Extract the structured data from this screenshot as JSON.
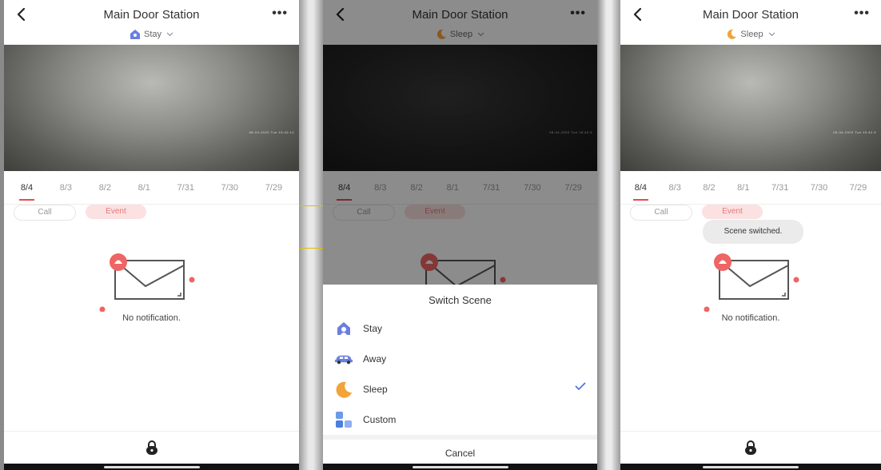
{
  "screens": [
    {
      "title": "Main Door Station",
      "more": "•••",
      "scene": "Stay",
      "stamp": "08-04-2020 Tue 15:42:12",
      "dates": [
        "8/4",
        "8/3",
        "8/2",
        "8/1",
        "7/31",
        "7/30",
        "7/29"
      ],
      "call_label": "Call",
      "event_label": "Event",
      "empty_message": "No notification."
    },
    {
      "title": "Main Door Station",
      "more": "•••",
      "scene": "Sleep",
      "stamp": "08-04-2020 Tue 15:42:3",
      "dates": [
        "8/4",
        "8/3",
        "8/2",
        "8/1",
        "7/31",
        "7/30",
        "7/29"
      ],
      "call_label": "Call",
      "event_label": "Event"
    },
    {
      "title": "Main Door Station",
      "more": "•••",
      "scene": "Sleep",
      "stamp": "08-04-2020 Tue 15:42:3",
      "dates": [
        "8/4",
        "8/3",
        "8/2",
        "8/1",
        "7/31",
        "7/30",
        "7/29"
      ],
      "call_label": "Call",
      "event_label": "Event",
      "toast": "Scene switched.",
      "empty_message": "No notification."
    }
  ],
  "switch_scene": {
    "title": "Switch Scene",
    "options": [
      "Stay",
      "Away",
      "Sleep",
      "Custom"
    ],
    "selected": "Sleep",
    "cancel": "Cancel"
  },
  "colors": {
    "accent": "#e94b4b",
    "event_chip_bg": "#fbe1e1",
    "check": "#4a6fd8",
    "stay_icon": "#6b7fe0",
    "sleep_icon": "#f2a33a"
  }
}
